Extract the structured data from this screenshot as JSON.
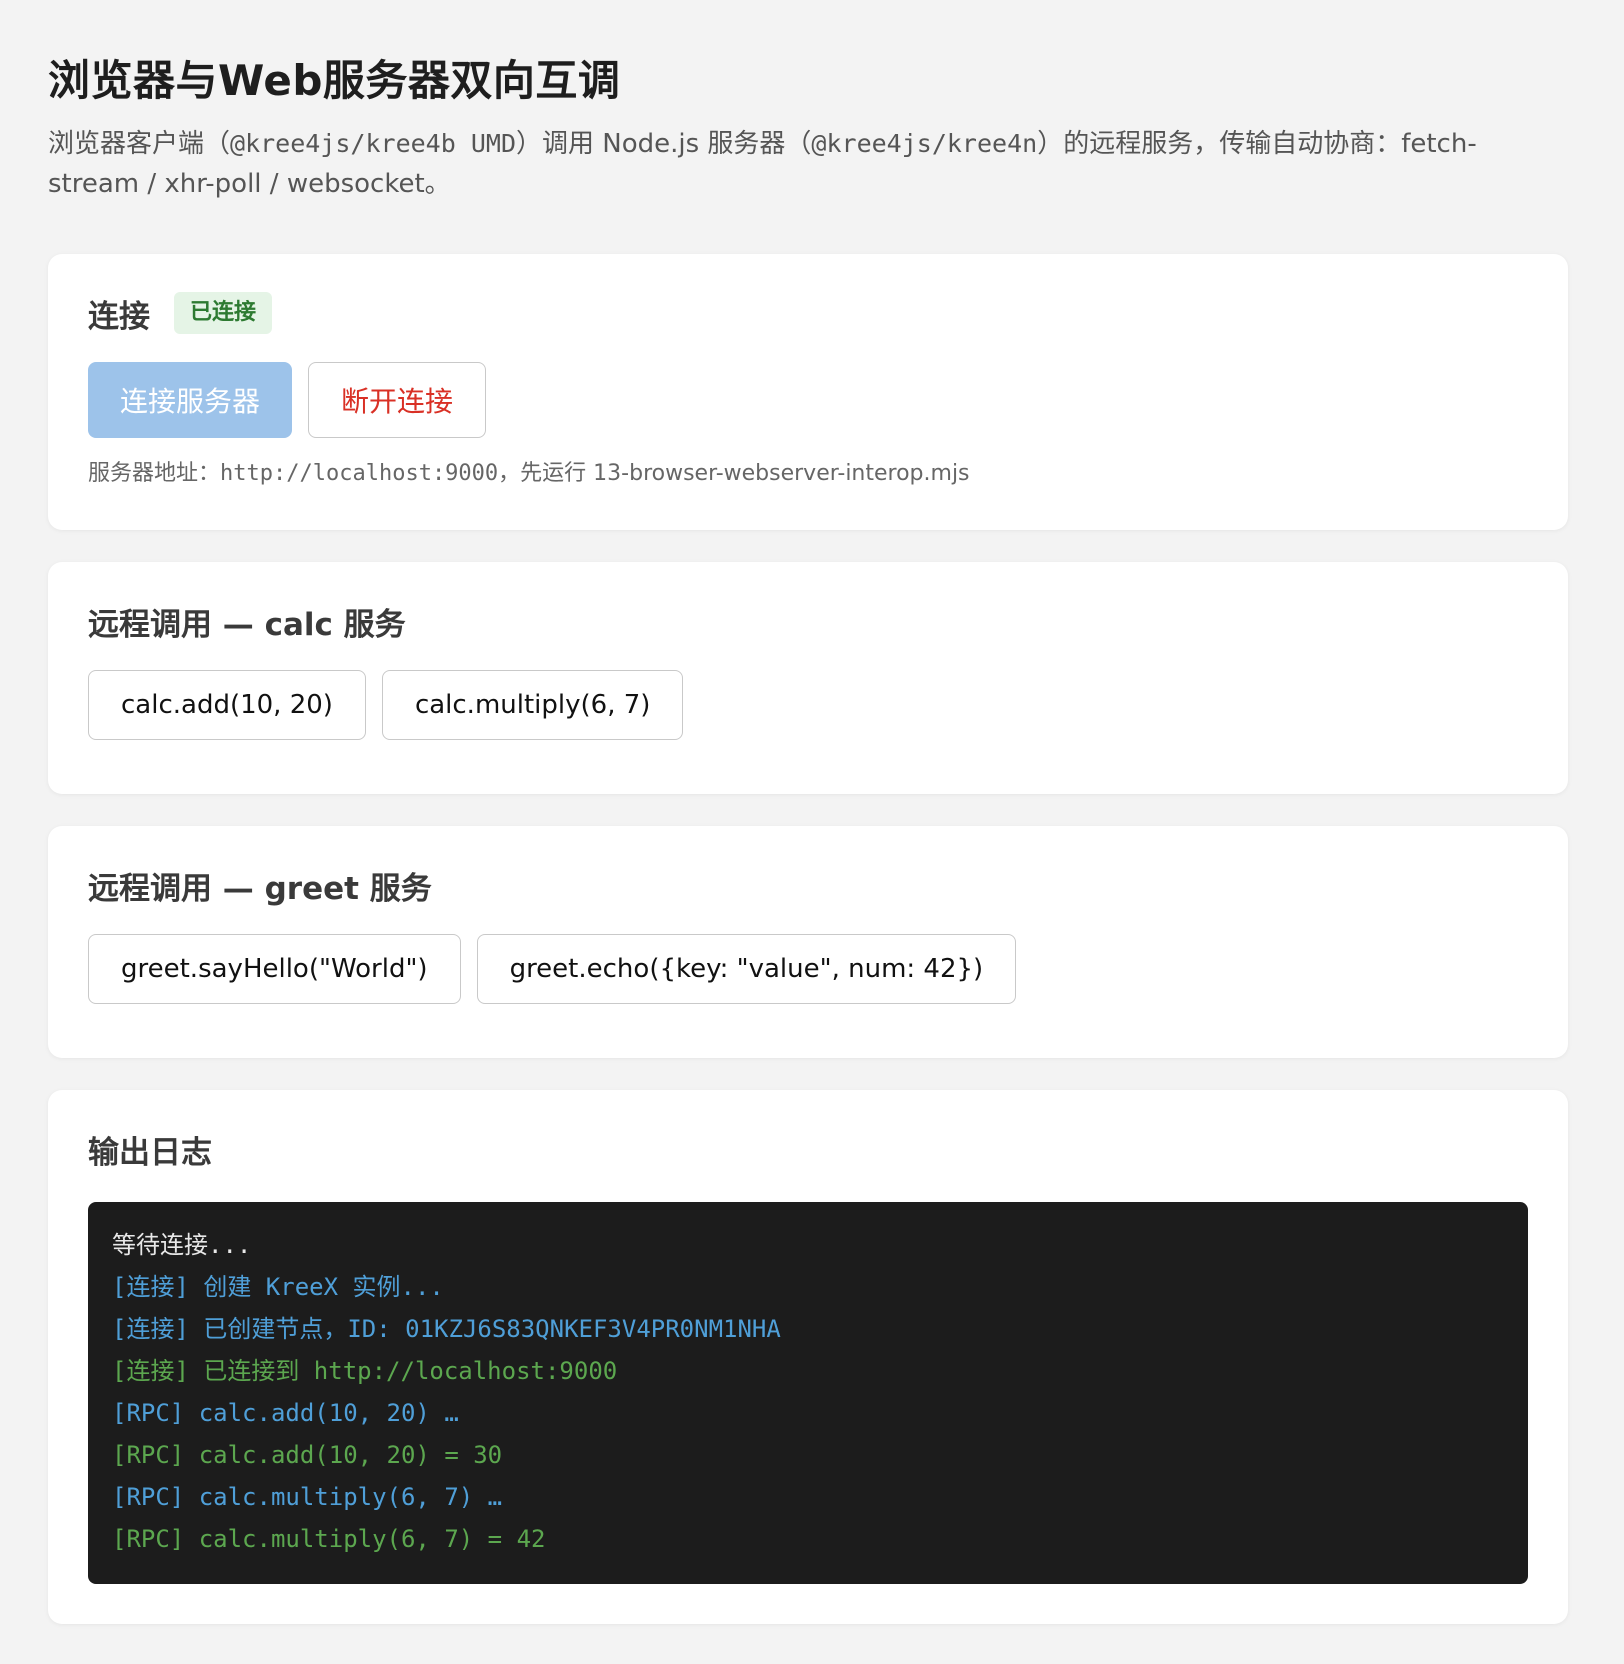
{
  "header": {
    "title": "浏览器与Web服务器双向互调",
    "subtitle_parts": [
      "浏览器客户端（",
      "@kree4js/kree4b UMD",
      "）调用 Node.js 服务器（",
      "@kree4js/kree4n",
      "）的远程服务，传输自动协商：fetch-stream / xhr-poll / websocket。"
    ]
  },
  "connection": {
    "title": "连接",
    "status": "已连接",
    "connect_label": "连接服务器",
    "disconnect_label": "断开连接",
    "hint_prefix": "服务器地址：",
    "hint_url": "http://localhost:9000",
    "hint_suffix": "，先运行 13-browser-webserver-interop.mjs"
  },
  "calc": {
    "title": "远程调用 — calc 服务",
    "add_label": "calc.add(10, 20)",
    "multiply_label": "calc.multiply(6, 7)"
  },
  "greet": {
    "title": "远程调用 — greet 服务",
    "hello_label": "greet.sayHello(\"World\")",
    "echo_label": "greet.echo({key: \"value\", num: 42})"
  },
  "log": {
    "title": "输出日志",
    "lines": [
      "等待连接...",
      "[连接] 创建 KreeX 实例...",
      "[连接] 已创建节点，ID: 01KZJ6S83QNKEF3V4PR0NM1NHA",
      "[连接] 已连接到 http://localhost:9000",
      "[RPC] calc.add(10, 20) …",
      "[RPC] calc.add(10, 20) = 30",
      "[RPC] calc.multiply(6, 7) …",
      "[RPC] calc.multiply(6, 7) = 42"
    ]
  },
  "colors": {
    "primary_button": "#9dc3ea",
    "danger_text": "#d93025",
    "status_badge_bg": "#e5f4e6",
    "status_badge_text": "#2d7a31",
    "log_bg": "#1c1c1c",
    "log_info": "#4f9fd8",
    "log_ok": "#5ca74f"
  }
}
